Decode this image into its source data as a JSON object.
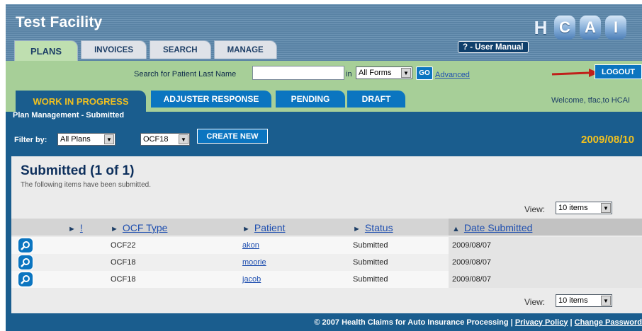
{
  "header": {
    "facility": "Test Facility",
    "logo_letters": [
      "H",
      "C",
      "A",
      "I"
    ],
    "manual": "? - User Manual"
  },
  "tabs": [
    {
      "label": "PLANS",
      "active": true
    },
    {
      "label": "INVOICES",
      "active": false
    },
    {
      "label": "SEARCH",
      "active": false
    },
    {
      "label": "MANAGE",
      "active": false
    }
  ],
  "search": {
    "label": "Search for Patient Last Name",
    "value": "",
    "in_label": "in",
    "forms_select": "All Forms",
    "go": "GO",
    "advanced": "Advanced",
    "logout": "LOGOUT"
  },
  "subtabs": [
    {
      "label": "WORK IN PROGRESS",
      "active": true
    },
    {
      "label": "ADJUSTER RESPONSE",
      "active": false
    },
    {
      "label": "PENDING",
      "active": false
    },
    {
      "label": "DRAFT",
      "active": false
    }
  ],
  "welcome": "Welcome, tfac,to HCAI",
  "breadcrumb": "Plan Management - Submitted",
  "filter": {
    "label": "Filter by:",
    "plans_select": "All Plans",
    "ocf_select": "OCF18",
    "create": "CREATE NEW",
    "date": "2009/08/10"
  },
  "panel": {
    "title": "Submitted (1 of 1)",
    "subtitle": "The following items have been submitted.",
    "view_label": "View:",
    "view_select": "10 items"
  },
  "columns": {
    "flag": "!",
    "ocf_type": "OCF Type",
    "patient": "Patient",
    "status": "Status",
    "date_submitted": "Date Submitted"
  },
  "rows": [
    {
      "ocf_type": "OCF22",
      "patient": "akon",
      "status": "Submitted",
      "date": "2009/08/07"
    },
    {
      "ocf_type": "OCF18",
      "patient": "moorie",
      "status": "Submitted",
      "date": "2009/08/07"
    },
    {
      "ocf_type": "OCF18",
      "patient": "jacob",
      "status": "Submitted",
      "date": "2009/08/07"
    }
  ],
  "footer": {
    "copyright": "© 2007 Health Claims for Auto Insurance Processing |",
    "privacy": "Privacy Policy",
    "separator": "|",
    "change_password": "Change Password"
  },
  "colors": {
    "navy": "#1a5d8e",
    "green": "#a7cf98",
    "accent_blue": "#0b75c0",
    "gold": "#f0c020",
    "arrow_red": "#c0201a"
  }
}
